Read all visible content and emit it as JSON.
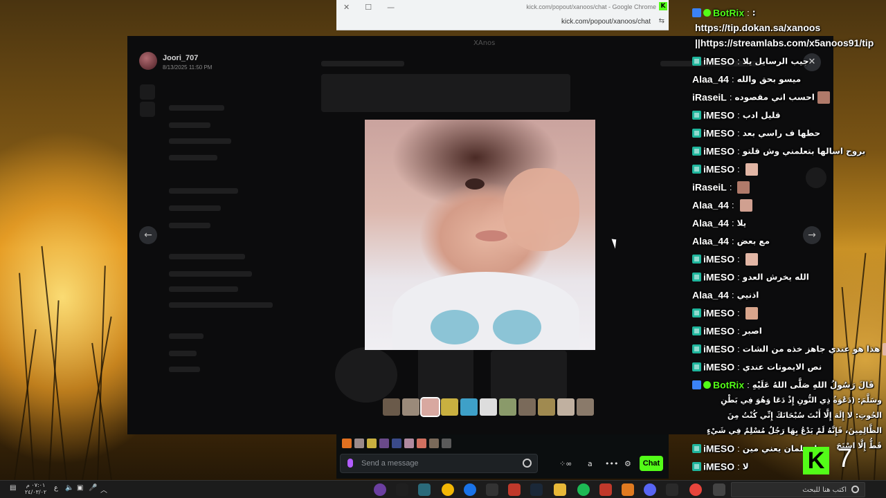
{
  "browser": {
    "title": "kick.com/popout/xanoos/chat - Google Chrome",
    "url": "kick.com/popout/xanoos/chat",
    "controls": [
      "✕",
      "☐",
      "—"
    ]
  },
  "viewer": {
    "app_title": "XAnos",
    "author": "Joori_707",
    "timestamp": "8/13/2025 11:50 PM",
    "close_glyph": "✕",
    "prev_glyph": "←",
    "next_glyph": "→",
    "thumb_count": 11
  },
  "chat": {
    "messages": [
      {
        "user": "BotRix",
        "badges": [
          "bot",
          "verified"
        ],
        "color": "green",
        "text": ":"
      },
      {
        "user": "iMESO",
        "badges": [
          "mod"
        ],
        "text": "جيب الرسايل يلا"
      },
      {
        "user": "Alaa_44",
        "badges": [],
        "text": "ميسو بحق والله"
      },
      {
        "user": "iRaseiL",
        "badges": [],
        "text": "احسب اني مقصوده"
      },
      {
        "user": "iMESO",
        "badges": [
          "mod"
        ],
        "text": "قليل ادب"
      },
      {
        "user": "iMESO",
        "badges": [
          "mod"
        ],
        "text": "حطها ف راسي بعد"
      },
      {
        "user": "iMESO",
        "badges": [
          "mod"
        ],
        "text": "بروح اسالها بتعلمني وش قلتو"
      },
      {
        "user": "iMESO",
        "badges": [
          "mod"
        ],
        "text": ""
      },
      {
        "user": "iRaseiL",
        "badges": [],
        "text": ""
      },
      {
        "user": "Alaa_44",
        "badges": [],
        "text": ""
      },
      {
        "user": "Alaa_44",
        "badges": [],
        "text": "يلا"
      },
      {
        "user": "Alaa_44",
        "badges": [],
        "text": "مع بعض"
      },
      {
        "user": "iMESO",
        "badges": [
          "mod"
        ],
        "text": ""
      },
      {
        "user": "iMESO",
        "badges": [
          "mod"
        ],
        "text": "الله يخرش العدو"
      },
      {
        "user": "Alaa_44",
        "badges": [],
        "text": "اذنيي"
      },
      {
        "user": "iMESO",
        "badges": [
          "mod"
        ],
        "text": ""
      },
      {
        "user": "iMESO",
        "badges": [
          "mod"
        ],
        "text": "اصبر"
      },
      {
        "user": "iMESO",
        "badges": [
          "mod"
        ],
        "text": "هذا هو عندي جاهز خذه من الشات"
      },
      {
        "user": "iMESO",
        "badges": [
          "mod"
        ],
        "text": "نص الايموتات عندي"
      },
      {
        "user": "BotRix",
        "badges": [
          "bot",
          "verified"
        ],
        "color": "green",
        "text": "قَالَ رَسُولُ اللهِ صَلَّى اللهُ عَلَيْهِ"
      },
      {
        "user": "iMESO",
        "badges": [
          "mod"
        ],
        "text": "بنا سلمان يعني مين"
      },
      {
        "user": "iMESO",
        "badges": [
          "mod"
        ],
        "text": "لا"
      }
    ],
    "botrix_link_1": "https://tip.dokan.sa/xanoos",
    "botrix_link_2": "||https://streamlabs.com/x5anoos91/tip",
    "botrix_long": "وسَلَّمَ: (دَعْوَةُ ذِي النُّونِ إِذْ دَعَا وَهُوَ فِي بَطْنِ الحُوتِ: لا إِلَهَ إِلَّا أَنْتَ سُبْحَانَكَ إِنِّي كُنْتُ مِنَ الظَّالِمِينَ، فَإِنَّهُ لَمْ يَدْعُ بِهَا رَجُلٌ مُسْلِمٌ فِي شَيْءٍ قَطُّ إِلَّا اسْتَجَ",
    "overlay_logo": "K",
    "overlay_number": "7"
  },
  "send_bar": {
    "placeholder": "Send a message",
    "chat_button": "Chat",
    "tool_glyphs": [
      "⁘∞",
      "a",
      "•••",
      "⚙"
    ]
  },
  "taskbar": {
    "time": "٠٧:٠١ م",
    "date": "٢٤/٠٣/٠٢",
    "lang": "ع",
    "search_placeholder": "اكتب هنا للبحث",
    "colors": {
      "accent_green": "#53fc18",
      "mod_teal": "#1fb59c",
      "bot_blue": "#3b82f6"
    }
  }
}
